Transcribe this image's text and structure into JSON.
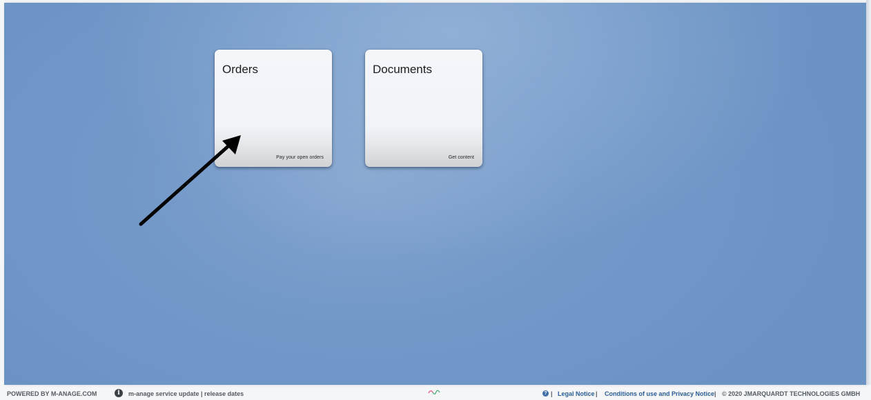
{
  "tiles": [
    {
      "title": "Orders",
      "subtitle": "Pay your open orders"
    },
    {
      "title": "Documents",
      "subtitle": "Get content"
    }
  ],
  "footer": {
    "powered_by": "POWERED BY M-ANAGE.COM",
    "info_icon_glyph": "i",
    "service_update": "m-anage service update | release dates",
    "help_icon_glyph": "?",
    "separator": "|",
    "legal_notice": "Legal Notice",
    "conditions": "Conditions of use and Privacy Notice",
    "copyright": "© 2020 JMARQUARDT TECHNOLOGIES GMBH"
  },
  "colors": {
    "background_blue": "#7399c9",
    "tile_background": "#f0f3f8",
    "link_blue": "#2b5d99",
    "wave_red": "#e0557a",
    "wave_green": "#4caf7a"
  },
  "icons": {
    "arrow": "arrow-annotation-icon",
    "info": "info-icon",
    "help": "help-icon",
    "logo": "wave-logo-icon"
  }
}
